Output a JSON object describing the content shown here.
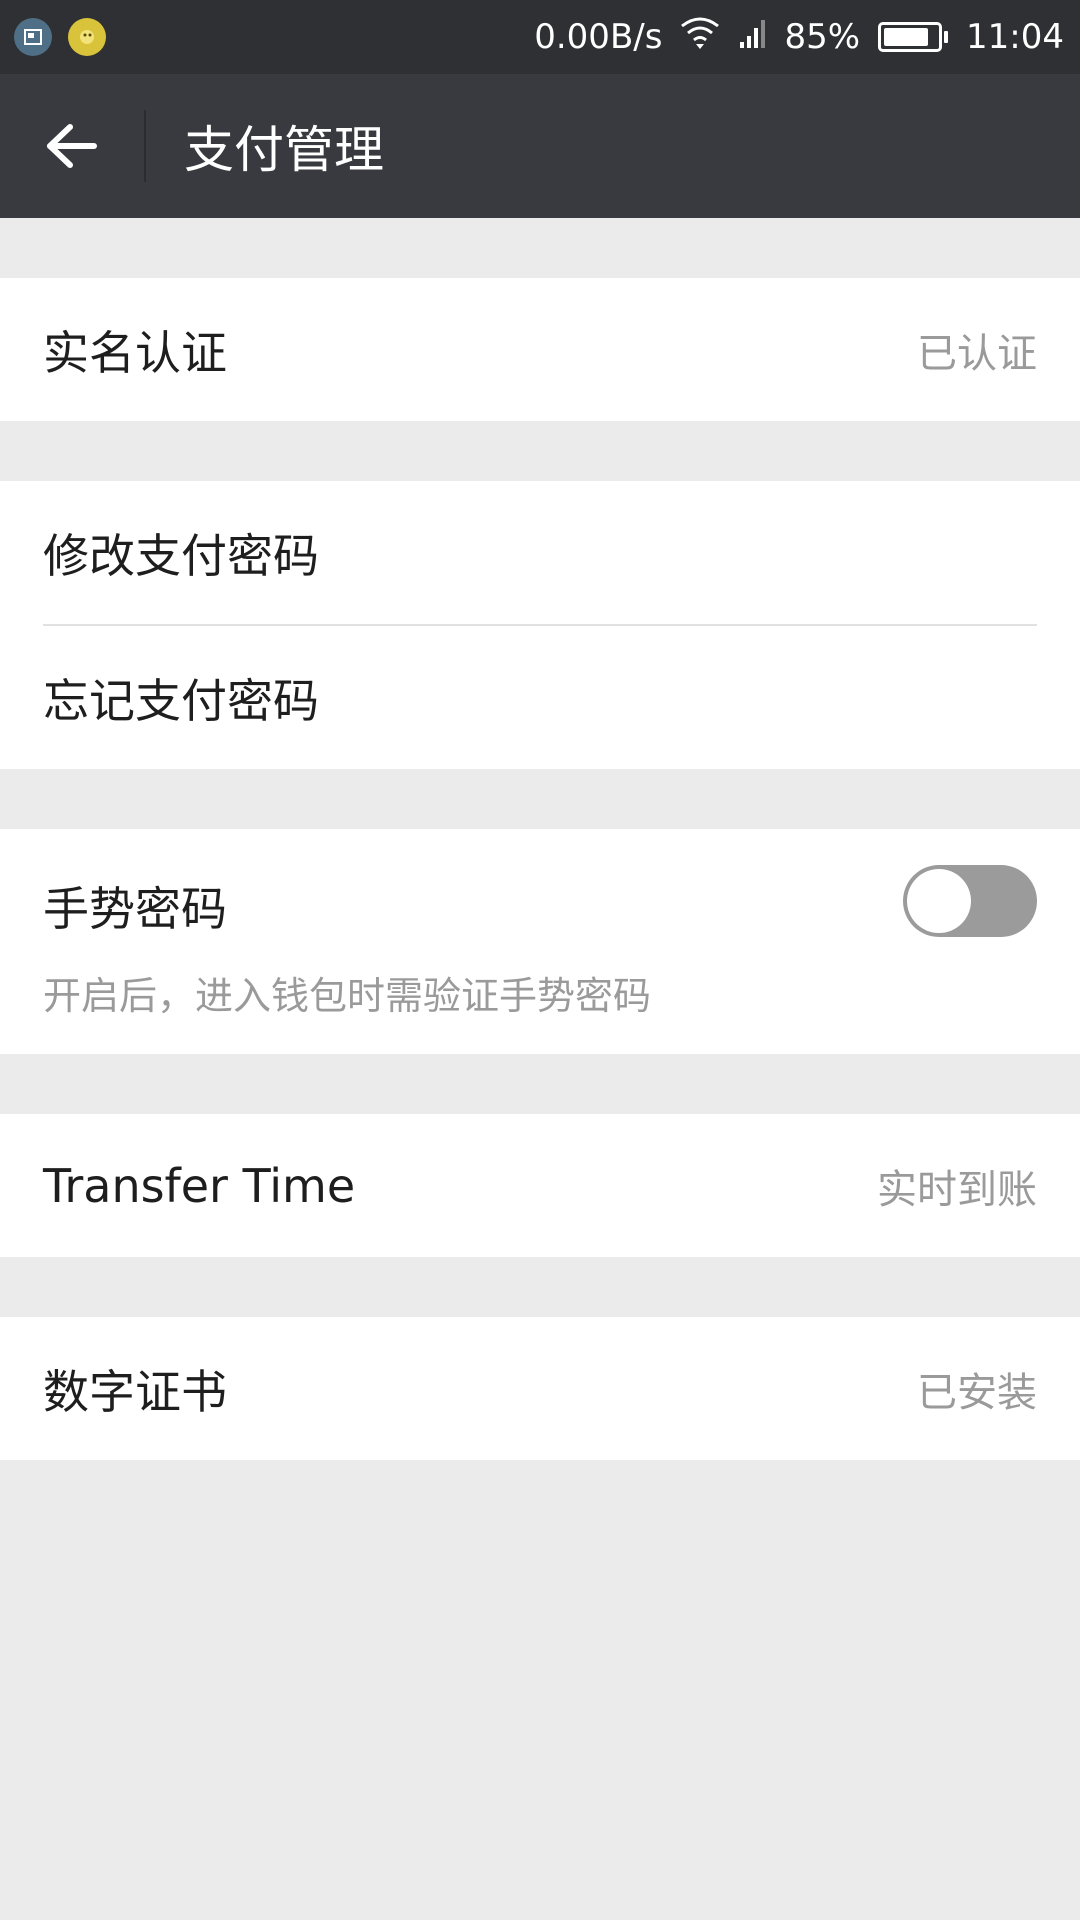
{
  "status_bar": {
    "net_speed": "0.00B/s",
    "battery_percent": "85%",
    "battery_level": 0.85,
    "time": "11:04",
    "icons": [
      "screenshot-notification-icon",
      "app-notification-icon",
      "wifi-icon",
      "signal-icon",
      "battery-icon"
    ]
  },
  "app_bar": {
    "title": "支付管理",
    "back_icon": "arrow-left-icon"
  },
  "sections": {
    "real_name": {
      "label": "实名认证",
      "value": "已认证"
    },
    "change_password": {
      "label": "修改支付密码"
    },
    "forgot_password": {
      "label": "忘记支付密码"
    },
    "gesture": {
      "label": "手势密码",
      "description": "开启后，进入钱包时需验证手势密码",
      "enabled": false
    },
    "transfer_time": {
      "label": "Transfer Time",
      "value": "实时到账"
    },
    "certificate": {
      "label": "数字证书",
      "value": "已安装"
    }
  },
  "colors": {
    "status_bar": "#2f3033",
    "app_bar": "#393a3f",
    "background": "#ebebeb",
    "secondary_text": "#9a9a9a",
    "toggle_off": "#9b9b9b"
  }
}
